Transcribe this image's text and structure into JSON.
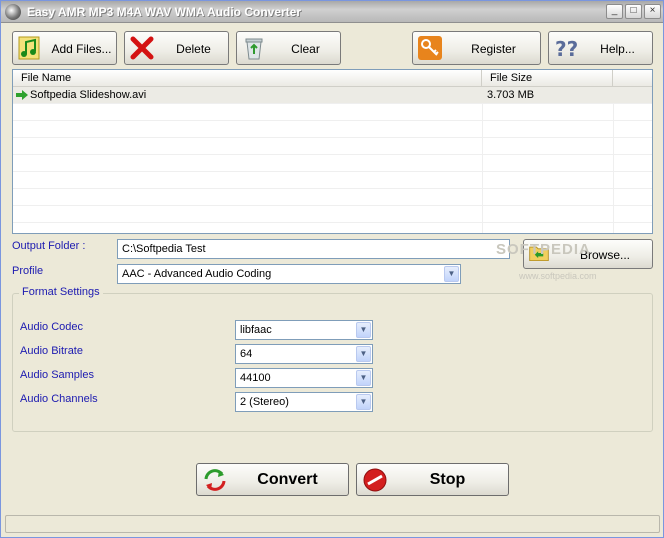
{
  "window": {
    "title": "Easy AMR MP3 M4A WAV WMA Audio Converter",
    "minimize": "_",
    "maximize": "□",
    "close": "×"
  },
  "toolbar": {
    "add_files": "Add Files...",
    "delete": "Delete",
    "clear": "Clear",
    "register": "Register",
    "help": "Help..."
  },
  "file_list": {
    "columns": [
      "File Name",
      "File Size"
    ],
    "rows": [
      {
        "name": "Softpedia Slideshow.avi",
        "size": "3.703 MB"
      }
    ]
  },
  "output": {
    "label": "Output Folder :",
    "value": "C:\\Softpedia Test",
    "browse": "Browse..."
  },
  "profile": {
    "label": "Profile",
    "value": "AAC - Advanced Audio Coding"
  },
  "format_settings": {
    "title": "Format Settings",
    "codec_label": "Audio Codec",
    "codec_value": "libfaac",
    "bitrate_label": "Audio Bitrate",
    "bitrate_value": "64",
    "samples_label": "Audio Samples",
    "samples_value": "44100",
    "channels_label": "Audio Channels",
    "channels_value": "2 (Stereo)"
  },
  "actions": {
    "convert": "Convert",
    "stop": "Stop"
  },
  "watermark": {
    "logo": "SOFTPEDIA",
    "url": "www.softpedia.com"
  },
  "icons": {
    "add_files": "music-note-add-icon",
    "delete": "red-x-icon",
    "clear": "recycle-bin-icon",
    "register": "key-icon",
    "help": "question-mark-icon",
    "browse": "folder-icon",
    "file_row": "green-arrow-icon",
    "convert": "refresh-arrows-icon",
    "stop": "stop-sign-icon"
  }
}
